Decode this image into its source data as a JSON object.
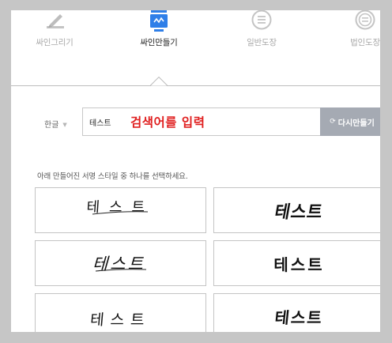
{
  "tabs": [
    {
      "label": "싸인그리기",
      "icon": "pen-draw-icon",
      "active": false
    },
    {
      "label": "싸인만들기",
      "icon": "signature-monitor-icon",
      "active": true
    },
    {
      "label": "일반도장",
      "icon": "round-stamp-icon",
      "active": false
    },
    {
      "label": "법인도장",
      "icon": "corporate-stamp-icon",
      "active": false
    }
  ],
  "language": {
    "selected": "한글"
  },
  "search": {
    "value": "테스트",
    "annotation": "검색어를 입력"
  },
  "regenerate_button": {
    "label": "다시만들기",
    "icon": "refresh-icon"
  },
  "hint": "아래 만들어진 서명 스타일 중 하나를 선택하세요.",
  "signatures": [
    {
      "text": "테스트",
      "style": "thin-handwritten"
    },
    {
      "text": "테스트",
      "style": "bold-brush"
    },
    {
      "text": "테스트",
      "style": "italic-handwritten"
    },
    {
      "text": "테스트",
      "style": "heavy-bold"
    },
    {
      "text": "테스트",
      "style": "loose-handwritten"
    },
    {
      "text": "테스트",
      "style": "bold-marker"
    }
  ],
  "colors": {
    "accent": "#2f7fe8",
    "annotation": "#e02020",
    "button": "#a5aab3"
  }
}
